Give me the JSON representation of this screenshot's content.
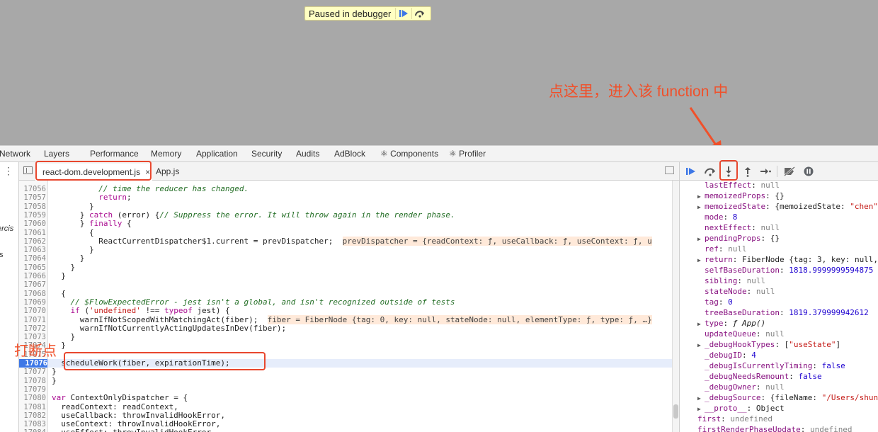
{
  "paused_banner": {
    "label": "Paused in debugger"
  },
  "annotations": {
    "step_into_note": "点这里，进入该 function 中",
    "breakpoint_note": "打断点"
  },
  "devtools_tabs": [
    "Network",
    "Layers",
    "Performance",
    "Memory",
    "Application",
    "Security",
    "Audits",
    "AdBlock",
    "⚛ Components",
    "⚛ Profiler"
  ],
  "left_panel": {
    "frag1": "ercis",
    "frag2": "s"
  },
  "file_tabs": [
    {
      "label": "react-dom.development.js",
      "close": "×"
    },
    {
      "label": "App.js"
    }
  ],
  "code_lines": [
    {
      "n": "17056",
      "text": "          // time the reducer has changed."
    },
    {
      "n": "17057",
      "text": "          return;"
    },
    {
      "n": "17058",
      "text": "        }"
    },
    {
      "n": "17059",
      "text": "      } catch (error) {// Suppress the error. It will throw again in the render phase."
    },
    {
      "n": "17060",
      "text": "      } finally {"
    },
    {
      "n": "17061",
      "text": "        {"
    },
    {
      "n": "17062",
      "text": "          ReactCurrentDispatcher$1.current = prevDispatcher;",
      "inline": "prevDispatcher = {readContext: ƒ, useCallback: ƒ, useContext: ƒ, u"
    },
    {
      "n": "17063",
      "text": "        }"
    },
    {
      "n": "17064",
      "text": "      }"
    },
    {
      "n": "17065",
      "text": "    }"
    },
    {
      "n": "17066",
      "text": "  }"
    },
    {
      "n": "17067",
      "text": ""
    },
    {
      "n": "17068",
      "text": "  {"
    },
    {
      "n": "17069",
      "text": "    // $FlowExpectedError - jest isn't a global, and isn't recognized outside of tests"
    },
    {
      "n": "17070",
      "text": "    if ('undefined' !== typeof jest) {"
    },
    {
      "n": "17071",
      "text": "      warnIfNotScopedWithMatchingAct(fiber);",
      "inline": "fiber = FiberNode {tag: 0, key: null, stateNode: null, elementType: ƒ, type: ƒ, …}"
    },
    {
      "n": "17072",
      "text": "      warnIfNotCurrentlyActingUpdatesInDev(fiber);"
    },
    {
      "n": "17073",
      "text": "    }"
    },
    {
      "n": "17074",
      "text": "  }"
    },
    {
      "n": "17075",
      "text": ""
    },
    {
      "n": "17076",
      "text": "  scheduleWork(fiber, expirationTime);",
      "highlight": true
    },
    {
      "n": "17077",
      "text": "}"
    },
    {
      "n": "17078",
      "text": "}"
    },
    {
      "n": "17079",
      "text": ""
    },
    {
      "n": "17080",
      "text": "var ContextOnlyDispatcher = {"
    },
    {
      "n": "17081",
      "text": "  readContext: readContext,"
    },
    {
      "n": "17082",
      "text": "  useCallback: throwInvalidHookError,"
    },
    {
      "n": "17083",
      "text": "  useContext: throwInvalidHookError,"
    },
    {
      "n": "17084",
      "text": "  useEffect: throwInvalidHookError,"
    }
  ],
  "scope_lines": [
    {
      "arrow": "",
      "name": "lastEffect",
      "value": "null",
      "kind": "null",
      "indent": 1
    },
    {
      "arrow": "▶",
      "name": "memoizedProps",
      "value": "{}",
      "kind": "obj",
      "indent": 1
    },
    {
      "arrow": "▶",
      "name": "memoizedState",
      "value": "{memoizedState: \"chen\"",
      "kind": "obj",
      "indent": 1
    },
    {
      "arrow": "",
      "name": "mode",
      "value": "8",
      "kind": "num",
      "indent": 1
    },
    {
      "arrow": "",
      "name": "nextEffect",
      "value": "null",
      "kind": "null",
      "indent": 1
    },
    {
      "arrow": "▶",
      "name": "pendingProps",
      "value": "{}",
      "kind": "obj",
      "indent": 1
    },
    {
      "arrow": "",
      "name": "ref",
      "value": "null",
      "kind": "null",
      "indent": 1
    },
    {
      "arrow": "▶",
      "name": "return",
      "value": "FiberNode {tag: 3, key: null,",
      "kind": "obj",
      "indent": 1
    },
    {
      "arrow": "",
      "name": "selfBaseDuration",
      "value": "1818.9999999594875",
      "kind": "num",
      "indent": 1
    },
    {
      "arrow": "",
      "name": "sibling",
      "value": "null",
      "kind": "null",
      "indent": 1
    },
    {
      "arrow": "",
      "name": "stateNode",
      "value": "null",
      "kind": "null",
      "indent": 1
    },
    {
      "arrow": "",
      "name": "tag",
      "value": "0",
      "kind": "num",
      "indent": 1
    },
    {
      "arrow": "",
      "name": "treeBaseDuration",
      "value": "1819.379999942612",
      "kind": "num",
      "indent": 1
    },
    {
      "arrow": "▶",
      "name": "type",
      "value": "ƒ App()",
      "kind": "fn",
      "indent": 1
    },
    {
      "arrow": "",
      "name": "updateQueue",
      "value": "null",
      "kind": "null",
      "indent": 1
    },
    {
      "arrow": "▶",
      "name": "_debugHookTypes",
      "value": "[\"useState\"]",
      "kind": "obj",
      "indent": 1
    },
    {
      "arrow": "",
      "name": "_debugID",
      "value": "4",
      "kind": "num",
      "indent": 1
    },
    {
      "arrow": "",
      "name": "_debugIsCurrentlyTiming",
      "value": "false",
      "kind": "num",
      "indent": 1
    },
    {
      "arrow": "",
      "name": "_debugNeedsRemount",
      "value": "false",
      "kind": "num",
      "indent": 1
    },
    {
      "arrow": "",
      "name": "_debugOwner",
      "value": "null",
      "kind": "null",
      "indent": 1
    },
    {
      "arrow": "▶",
      "name": "_debugSource",
      "value": "{fileName: \"/Users/shun",
      "kind": "obj",
      "indent": 1
    },
    {
      "arrow": "▶",
      "name": "__proto__",
      "value": "Object",
      "kind": "obj",
      "indent": 1
    },
    {
      "arrow": "",
      "name": "first",
      "value": "undefined",
      "kind": "null",
      "indent": 0
    },
    {
      "arrow": "",
      "name": "firstRenderPhaseUpdate",
      "value": "undefined",
      "kind": "null",
      "indent": 0
    }
  ],
  "colors": {
    "accent_blue": "#3d77e6",
    "annotation_red": "#f0502a",
    "banner_bg": "#ffffc2"
  }
}
